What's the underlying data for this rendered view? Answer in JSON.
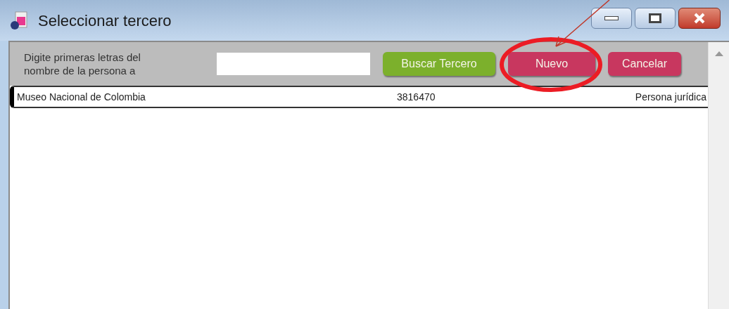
{
  "window": {
    "title": "Seleccionar tercero"
  },
  "search": {
    "label": "Digite primeras letras del nombre de la persona a"
  },
  "buttons": [
    {
      "label": "Buscar Tercero",
      "kind": "search",
      "highlighted": false
    },
    {
      "label": "Nuevo",
      "kind": "new",
      "highlighted": true
    },
    {
      "label": "Cancelar",
      "kind": "cancel",
      "highlighted": false
    }
  ],
  "rows": [
    {
      "name": "Museo Nacional de Colombia",
      "phone": "3816470",
      "type": "Persona jurídica",
      "selected": true
    }
  ]
}
